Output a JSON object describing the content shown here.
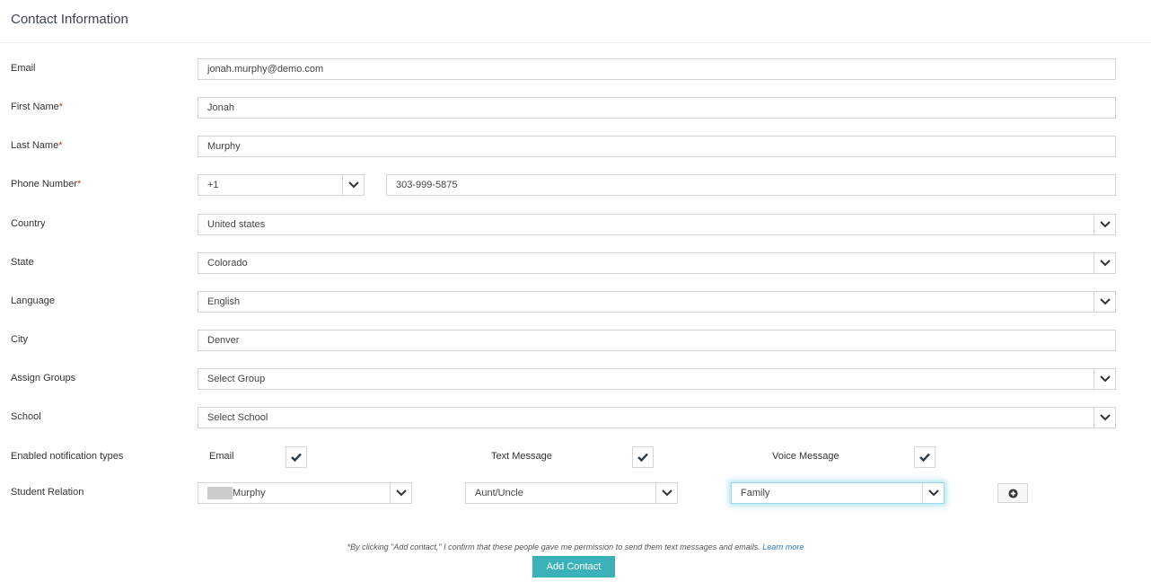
{
  "header": {
    "title": "Contact Information"
  },
  "form": {
    "email": {
      "label": "Email",
      "value": "jonah.murphy@demo.com"
    },
    "first_name": {
      "label": "First Name",
      "required": "*",
      "value": "Jonah"
    },
    "last_name": {
      "label": "Last Name",
      "required": "*",
      "value": "Murphy"
    },
    "phone": {
      "label": "Phone Number",
      "required": "*",
      "country_code": "+1",
      "number": "303-999-5875"
    },
    "country": {
      "label": "Country",
      "value": "United states"
    },
    "state": {
      "label": "State",
      "value": "Colorado"
    },
    "language": {
      "label": "Language",
      "value": "English"
    },
    "city": {
      "label": "City",
      "value": "Denver"
    },
    "groups": {
      "label": "Assign Groups",
      "value": "Select Group"
    },
    "school": {
      "label": "School",
      "value": "Select School"
    },
    "notifications": {
      "label": "Enabled notification types",
      "email_label": "Email",
      "text_label": "Text Message",
      "voice_label": "Voice Message",
      "email_checked": true,
      "text_checked": true,
      "voice_checked": true
    },
    "student_relation": {
      "label": "Student Relation",
      "student": "Murphy",
      "relation": "Aunt/Uncle",
      "category": "Family"
    }
  },
  "footer": {
    "disclaimer": "*By clicking \"Add contact,\" I confirm that these people gave me permission to send them text messages and emails.",
    "learn_more": "Learn more",
    "add_button": "Add Contact"
  },
  "colors": {
    "accent": "#3bb1b9",
    "link": "#2a7db5",
    "required": "#c0392b"
  },
  "icons": {
    "dropdown": "chevron-down-icon",
    "check": "check-icon",
    "add": "plus-circle-icon"
  }
}
